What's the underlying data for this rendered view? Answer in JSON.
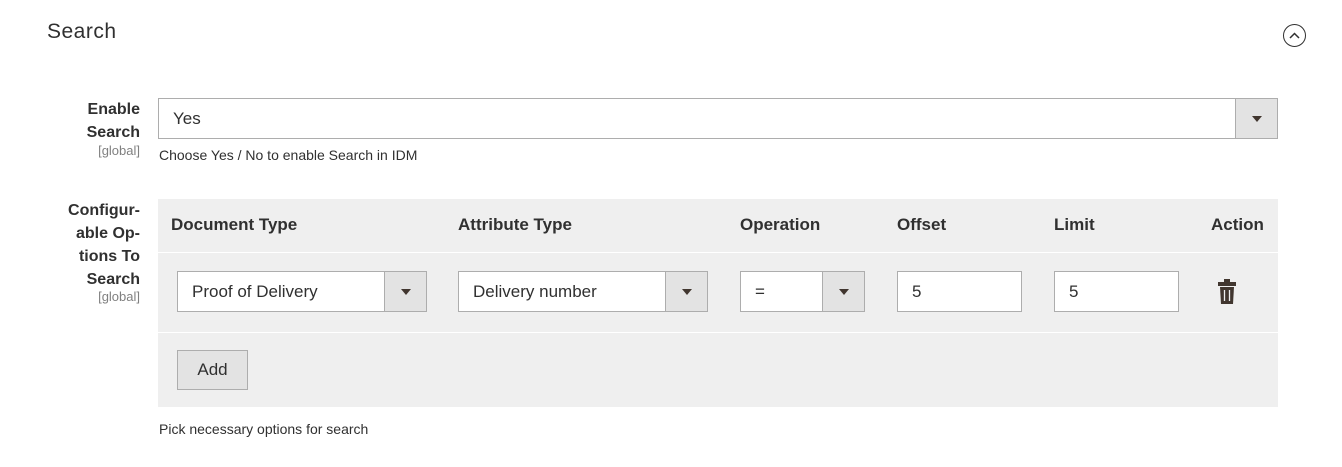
{
  "section": {
    "title": "Search",
    "collapse_icon": "chevron-up-circle-icon"
  },
  "enable_search": {
    "label_line1": "Enable",
    "label_line2": "Search",
    "scope": "[global]",
    "value": "Yes",
    "note": "Choose Yes / No to enable Search in IDM"
  },
  "configurable_options": {
    "label_line1": "Configur-",
    "label_line2": "able Op-",
    "label_line3": "tions To",
    "label_line4": "Search",
    "scope": "[global]",
    "columns": [
      "Document Type",
      "Attribute Type",
      "Operation",
      "Offset",
      "Limit",
      "Action"
    ],
    "rows": [
      {
        "document_type": "Proof of Delivery",
        "attribute_type": "Delivery number",
        "operation": "=",
        "offset": "5",
        "limit": "5",
        "action_icon": "trash-icon"
      }
    ],
    "add_label": "Add",
    "note": "Pick necessary options for search"
  },
  "colors": {
    "grid_background": "#efefef",
    "select_arrow_background": "#e3e3e3",
    "border": "#adadad",
    "text": "#303030",
    "scope_text": "#808080"
  }
}
